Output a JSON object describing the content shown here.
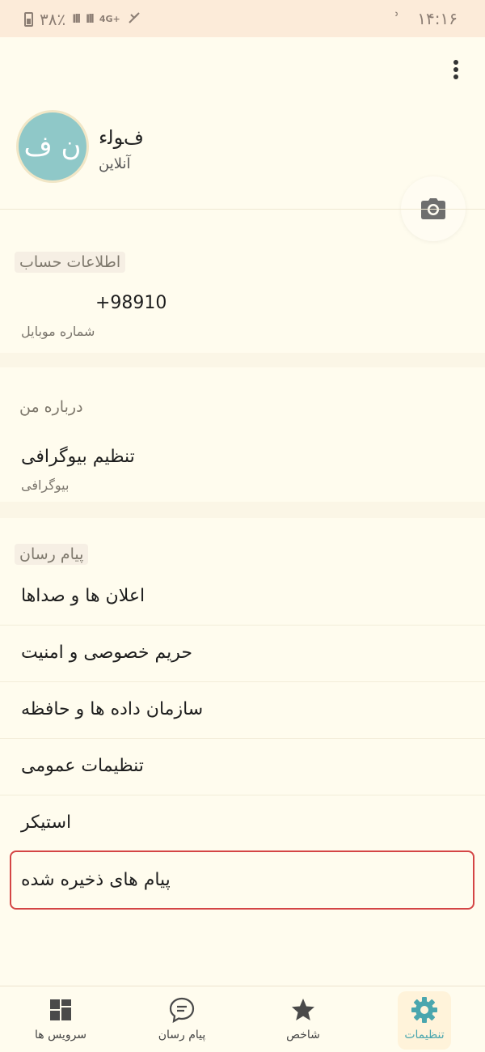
{
  "status_bar": {
    "time": "۱۴:۱۶",
    "right_glyph": "ʾ",
    "battery_percent": "۳۸٪",
    "network": "4G+"
  },
  "profile": {
    "avatar_initials": "ﻥ ﻑ",
    "name": "ﻑﻮﻟﺀ",
    "status": "ﺁﻧﻼﯾﻦ"
  },
  "account": {
    "title": "ﺍﻃﻼﻋﺎﺕ ﺣﺴﺎﺏ",
    "phone": "+98910",
    "phone_label": "ﺷﻤﺎﺭﻩ ﻣﻮﺑﺎﯾﻞ"
  },
  "bio": {
    "title": "ﺩﺭﺑﺎﺭﻩ ﻣﻦ",
    "primary": "ﺗﻨﻈﯿﻢ ﺑﯿﻮﮔﺮﺍﻓﯽ",
    "secondary": "ﺑﯿﻮﮔﺮﺍﻓﯽ"
  },
  "messenger": {
    "title": "ﭘﯿﺎﻡ ﺭﺳﺎﻥ",
    "items": [
      "ﺍﻋﻼﻥ ﻫﺎ ﻭ ﺻﺪﺍﻫﺎ",
      "ﺣﺮﯾﻢ ﺧﺼﻮﺻﯽ ﻭ ﺍﻣﻨﯿﺖ",
      "ﺳﺎﺯﻣﺎﻥ ﺩﺍﺩﻩ ﻫﺎ ﻭ ﺣﺎﻓﻈﻪ",
      "ﺗﻨﻈﯿﻤﺎﺕ ﻋﻤﻮﻣﯽ",
      "ﺍﺳﺘﯿﮑﺮ",
      "ﭘﯿﺎﻡ ﻫﺎﯼ ﺫﺧﯿﺮﻩ ﺷﺪﻩ"
    ]
  },
  "bottom_nav": {
    "items": [
      {
        "label": "ﺳﺮﻭﯾﺲ ﻫﺎ",
        "icon": "grid-icon"
      },
      {
        "label": "ﭘﯿﺎﻡ ﺭﺳﺎﻥ",
        "icon": "chat-bubble-icon"
      },
      {
        "label": "ﺷﺎﺧﺺ",
        "icon": "star-icon"
      },
      {
        "label": "ﺗﻨﻈﯿﻤﺎﺕ",
        "icon": "gear-icon"
      }
    ]
  },
  "colors": {
    "accent": "#4AA6AE",
    "avatar_bg": "#8FC8C8",
    "highlight": "#D44545",
    "status_bar_bg": "#FCEBD9"
  }
}
